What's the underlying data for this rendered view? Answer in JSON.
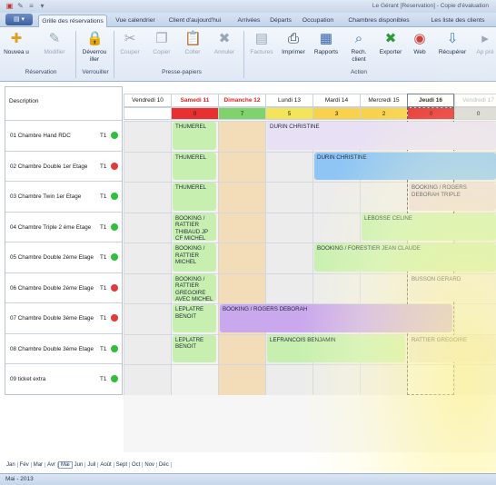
{
  "window": {
    "title": "Le Gérant [Reservation] - Copie d'évaluation"
  },
  "tabs": [
    "Grille des réservations",
    "Vue calendrier",
    "Client d'aujourd'hui",
    "Arrivées",
    "Départs",
    "Occupation",
    "Chambres disponibles",
    "Les liste des clients"
  ],
  "ribbon": {
    "buttons": {
      "nouveau": "Nouvea u",
      "modifier": "Modifier",
      "deverrouiller": "Déverrou iller",
      "couper": "Couper",
      "copier": "Copier",
      "coller": "Coller",
      "annuler": "Annuler",
      "factures": "Factures",
      "imprimer": "Imprimer",
      "rapports": "Rapports",
      "rech_client": "Rech. client",
      "exporter": "Exporter",
      "web": "Web",
      "recuperer": "Récupérer",
      "apres": "Ap pré"
    },
    "groups": {
      "reservation": "Réservation",
      "verrouiller": "Verrouiller",
      "presse": "Presse-papiers",
      "action": "Action"
    }
  },
  "grid": {
    "desc_header": "Description",
    "days": [
      "Vendredi 10",
      "Samedi 11",
      "Dimanche 12",
      "Lundi 13",
      "Mardi 14",
      "Mercredi 15",
      "Jeudi 16",
      "Vendredi 17"
    ],
    "counts": [
      "",
      "0",
      "7",
      "5",
      "3",
      "2",
      "0",
      "0"
    ],
    "rooms": [
      {
        "name": "01  Chambre Hand RDC",
        "t": "T1",
        "status": "green"
      },
      {
        "name": "02  Chambre  Double 1er Etage",
        "t": "T1",
        "status": "red"
      },
      {
        "name": "03  Chambre Twin 1er Etage",
        "t": "T1",
        "status": "green"
      },
      {
        "name": "04  Chambre Triple 2 éme Etage",
        "t": "T1",
        "status": "green"
      },
      {
        "name": "05  Chambre Double 2éme Etage",
        "t": "T1",
        "status": "green"
      },
      {
        "name": "06  Chambre Double 2éme Etage",
        "t": "T1",
        "status": "red"
      },
      {
        "name": "07  Chambre Double 3éme Etage",
        "t": "T1",
        "status": "red"
      },
      {
        "name": "08  Chambre Double 3éme Etage",
        "t": "T1",
        "status": "green"
      },
      {
        "name": "09  ticket extra",
        "t": "T1",
        "status": "green"
      }
    ],
    "bookings": [
      {
        "text": "THUMEREL"
      },
      {
        "text": "DURIN CHRISTINE"
      },
      {
        "text": "THUMEREL"
      },
      {
        "text": "DURIN CHRISTINE"
      },
      {
        "text": "THUMEREL"
      },
      {
        "text": "BOOKING / ROGERS DEBORAH TRIPLE"
      },
      {
        "text": "BOOKING / RATTIER THIBAUD JP CF MICHEL"
      },
      {
        "text": "LEBOSSE CELINE"
      },
      {
        "text": "BOOKING / RATTIER MICHEL"
      },
      {
        "text": "BOOKING / FORESTIER JEAN CLAUDE"
      },
      {
        "text": "BOOKING / RATTIER GREGOIRE AVEC MICHEL"
      },
      {
        "text": "BUSSON GERARD"
      },
      {
        "text": "LEPLATRE BENOIT"
      },
      {
        "text": "BOOKING / ROGERS DEBORAH"
      },
      {
        "text": "LEPLATRE BENOIT"
      },
      {
        "text": "LEFRANCOIS BENJAMIN"
      },
      {
        "text": "RATTIER GREGOIRE"
      }
    ]
  },
  "months": [
    "Jan",
    "Fév",
    "Mar",
    "Avr",
    "Mai",
    "Jun",
    "Juil",
    "Août",
    "Sept",
    "Oct",
    "Nov",
    "Déc"
  ],
  "status": "Mai - 2013",
  "colors": {
    "green": "#2fbf3a",
    "red": "#e03a3a",
    "today_hdr": "#e83030",
    "weekend_fill": "#f3dcb8"
  }
}
